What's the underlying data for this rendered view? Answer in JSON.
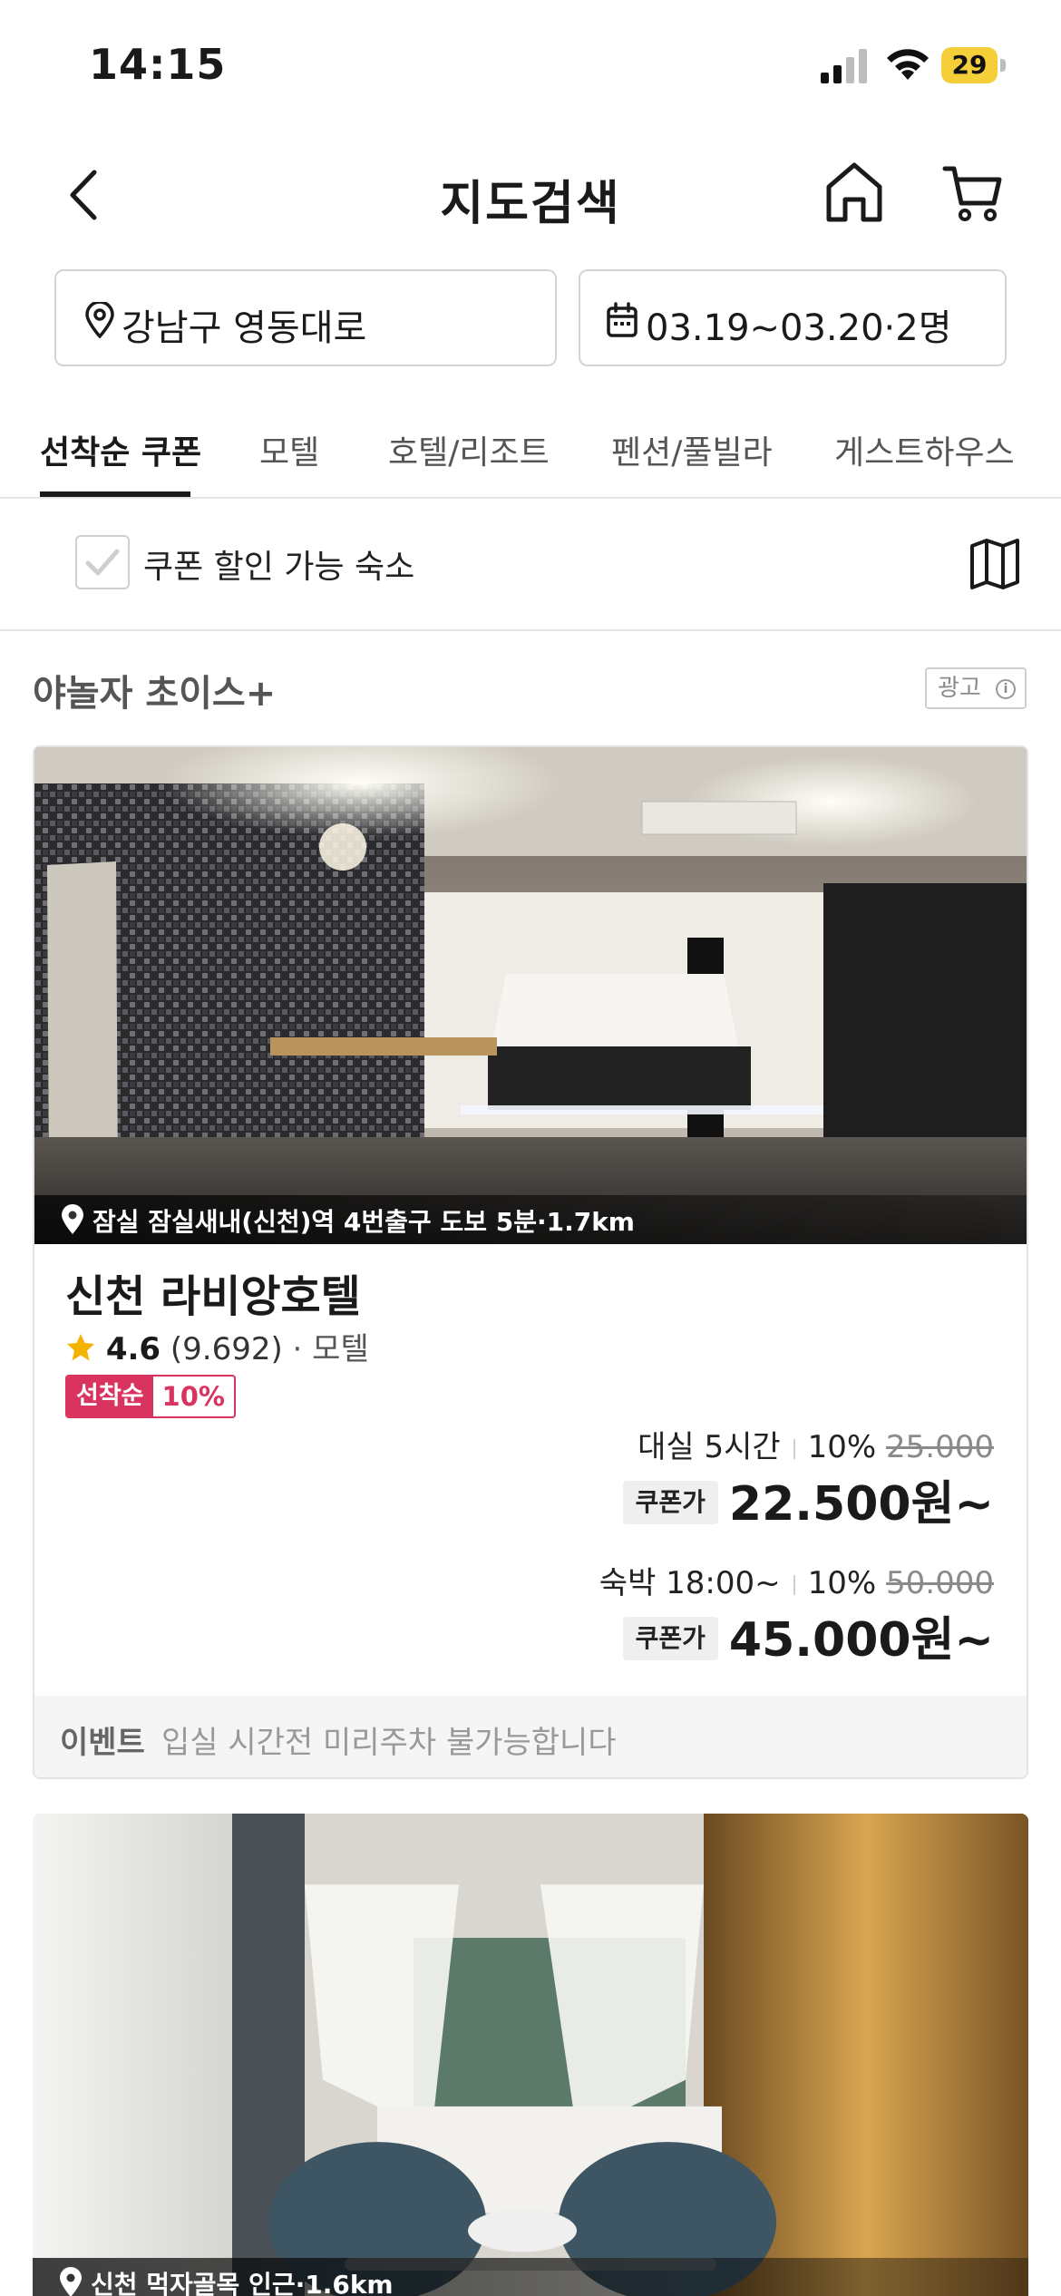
{
  "status_bar": {
    "time": "14:15",
    "battery": "29"
  },
  "header": {
    "title": "지도검색"
  },
  "search": {
    "location": "강남구 영동대로",
    "dates": "03.19~03.20·2명"
  },
  "tabs": [
    {
      "label": "선착순 쿠폰",
      "active": true
    },
    {
      "label": "모텔",
      "active": false
    },
    {
      "label": "호텔/리조트",
      "active": false
    },
    {
      "label": "펜션/풀빌라",
      "active": false
    },
    {
      "label": "게스트하우스",
      "active": false
    }
  ],
  "filter": {
    "checkbox_label": "쿠폰 할인 가능 숙소",
    "checked": false
  },
  "section": {
    "title": "야놀자 초이스+",
    "ad_label": "광고",
    "ad_info": "i"
  },
  "listings": [
    {
      "location": "잠실 잠실새내(신천)역 4번출구 도보 5분·1.7km",
      "name": "신천 라비앙호텔",
      "rating": "4.6",
      "review_count": "(9.692)",
      "separator": " · ",
      "type": "모텔",
      "coupon_tag_label": "선착순",
      "coupon_tag_pct": "10%",
      "prices": [
        {
          "label": "대실 5시간",
          "discount": "10%",
          "original": "25.000",
          "coupon_label": "쿠폰가",
          "final": "22.500원~"
        },
        {
          "label": "숙박 18:00~",
          "discount": "10%",
          "original": "50.000",
          "coupon_label": "쿠폰가",
          "final": "45.000원~"
        }
      ],
      "event_label": "이벤트",
      "event_text": "입실 시간전 미리주차 불가능합니다"
    },
    {
      "location": "신천 먹자골목 인근·1.6km"
    }
  ],
  "colors": {
    "accent": "#d8345f",
    "star": "#f5b301",
    "text": "#1a1a1a",
    "border": "#d4d4d4"
  }
}
